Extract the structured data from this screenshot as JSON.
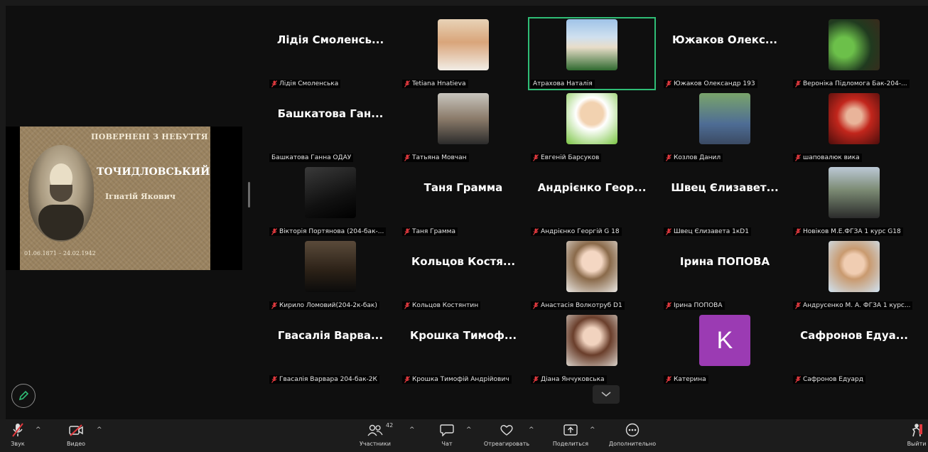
{
  "share": {
    "title_line": "ПОВЕРНЕНІ З НЕБУТТЯ",
    "surname": "ТОЧИДЛОВСЬКИЙ",
    "name": "Ігнатій Якович",
    "dates": "01.06.1871 – 24.02.1942"
  },
  "tiles": [
    {
      "name": "Лідія Смоленсь...",
      "label": "Лідія Смоленська",
      "muted": true
    },
    {
      "name": "",
      "label": "Tetiana Hnatieva",
      "muted": true,
      "photo": "portrait-light"
    },
    {
      "name": "",
      "label": "Атраxова Наталія",
      "muted": false,
      "photo": "building",
      "active": true
    },
    {
      "name": "Южаков Олекс...",
      "label": "Южаков Олександр 193",
      "muted": true
    },
    {
      "name": "",
      "label": "Вероніка Підломога Бак-204-...",
      "muted": true,
      "photo": "green"
    },
    {
      "name": "Башкатова Ган...",
      "label": "Башкатова Ганна ОДАУ",
      "muted": false
    },
    {
      "name": "",
      "label": "Татьяна Мовчан",
      "muted": true,
      "photo": "portrait-dark"
    },
    {
      "name": "",
      "label": "Евгеній Барсуков",
      "muted": true,
      "photo": "boy-green"
    },
    {
      "name": "",
      "label": "Козлов Данил",
      "muted": true,
      "photo": "outdoor"
    },
    {
      "name": "",
      "label": "шаповалюк вика",
      "muted": true,
      "photo": "red-hair"
    },
    {
      "name": "",
      "label": "Вікторія Портянова (204-бак-...",
      "muted": true,
      "photo": "dark"
    },
    {
      "name": "Таня Грамма",
      "label": "Таня Грамма",
      "muted": true
    },
    {
      "name": "Андрієнко Геор...",
      "label": "Андрієнко Георгій G 18",
      "muted": true
    },
    {
      "name": "Швец Єлизавет...",
      "label": "Швец Єлизавета 1кD1",
      "muted": true
    },
    {
      "name": "",
      "label": "Новіков М.Е.ФГЗА 1 курс G18",
      "muted": true,
      "photo": "moto"
    },
    {
      "name": "",
      "label": "Кирило Ломовий(204-2к-бак)",
      "muted": true,
      "photo": "dark-room"
    },
    {
      "name": "Кольцов Костя...",
      "label": "Кольцов Костянтин",
      "muted": true
    },
    {
      "name": "",
      "label": "Анастасія Волкотруб D1",
      "muted": true,
      "photo": "girl"
    },
    {
      "name": "Ірина ПОПОВА",
      "label": "Ірина ПОПОВА",
      "muted": true
    },
    {
      "name": "",
      "label": "Андрусенко М. А. ФГЗА 1 курс...",
      "muted": true,
      "photo": "boy-light"
    },
    {
      "name": "Гвасалія Варва...",
      "label": "Гвасалія Варвара 204-бак-2К",
      "muted": true
    },
    {
      "name": "Крошка Тимоф...",
      "label": "Крошка Тимофій Андрійович",
      "muted": true
    },
    {
      "name": "",
      "label": "Діана Янчуковська",
      "muted": true,
      "photo": "girl2"
    },
    {
      "name": "",
      "label": "Катерина",
      "muted": true,
      "avatar": "K"
    },
    {
      "name": "Сафронов Едуа...",
      "label": "Сафронов Едуард",
      "muted": true
    }
  ],
  "toolbar": {
    "audio_label": "Звук",
    "video_label": "Видео",
    "participants_label": "Участники",
    "participants_count": "42",
    "chat_label": "Чат",
    "react_label": "Отреагировать",
    "share_label": "Поделиться",
    "more_label": "Дополнительно",
    "leave_label": "Выйти"
  },
  "colors": {
    "active_border": "#2fbd76",
    "muted_icon": "#e0393e",
    "avatar_bg": "#9b3bb3"
  }
}
